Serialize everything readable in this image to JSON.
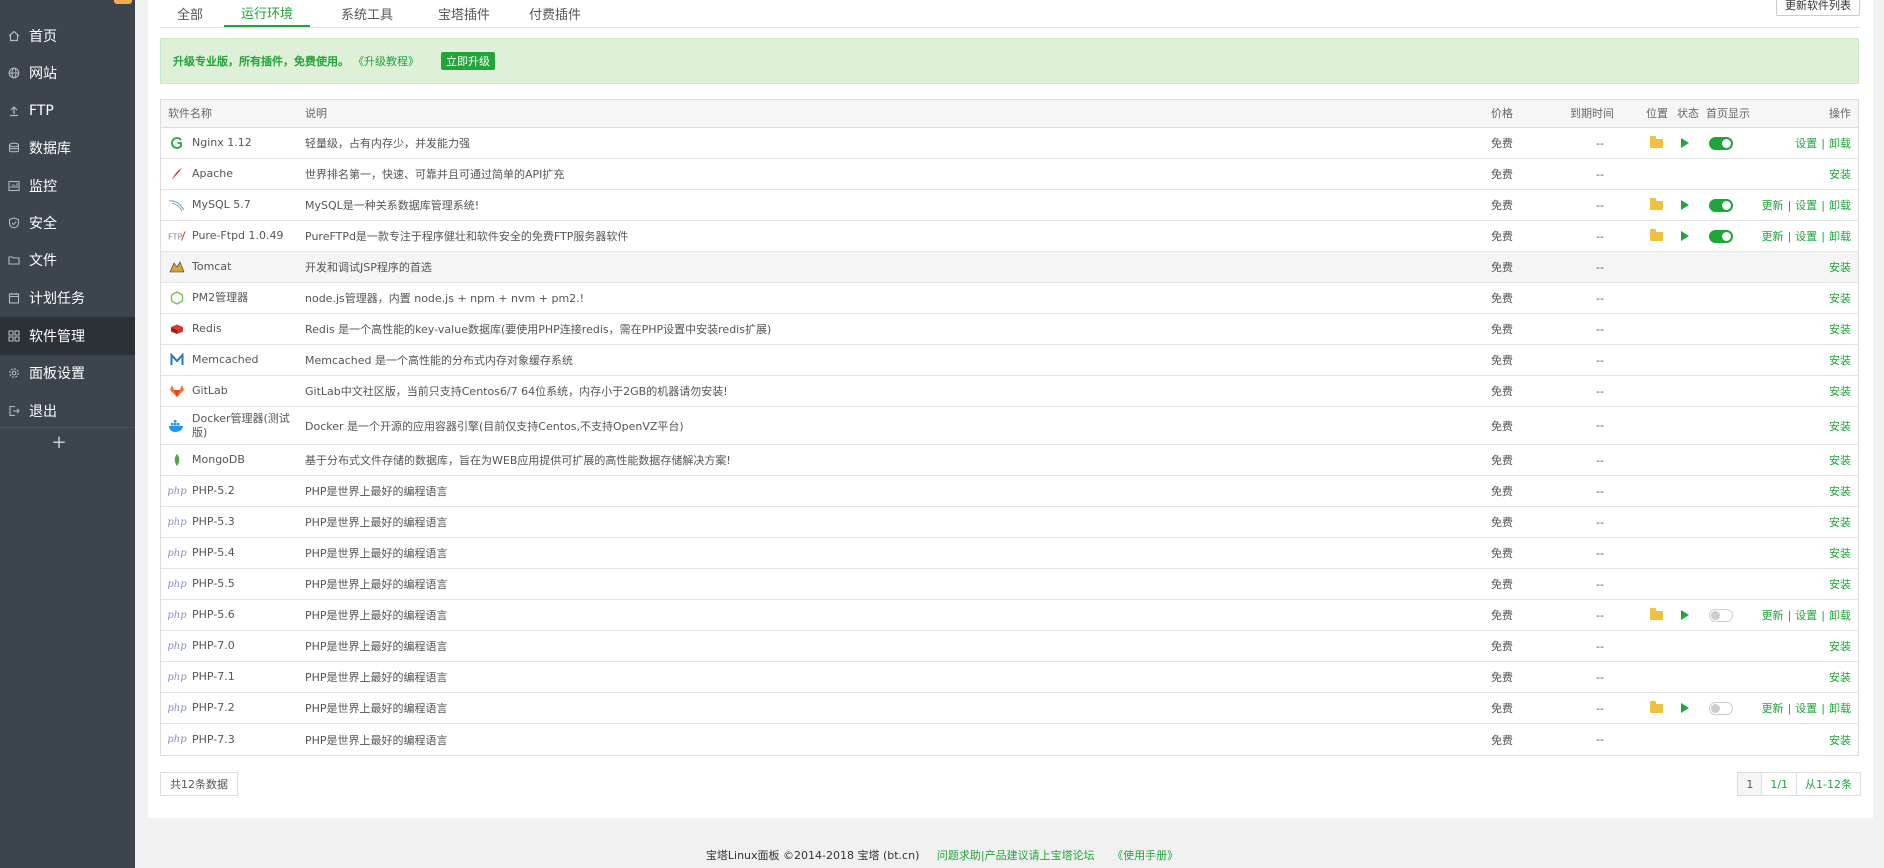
{
  "sidebar": {
    "items": [
      {
        "label": "首页",
        "icon": "home-icon"
      },
      {
        "label": "网站",
        "icon": "globe-icon"
      },
      {
        "label": "FTP",
        "icon": "upload-icon"
      },
      {
        "label": "数据库",
        "icon": "database-icon"
      },
      {
        "label": "监控",
        "icon": "monitor-icon"
      },
      {
        "label": "安全",
        "icon": "shield-icon"
      },
      {
        "label": "文件",
        "icon": "folder-icon"
      },
      {
        "label": "计划任务",
        "icon": "calendar-icon"
      },
      {
        "label": "软件管理",
        "icon": "grid-icon"
      },
      {
        "label": "面板设置",
        "icon": "gear-icon"
      },
      {
        "label": "退出",
        "icon": "logout-icon"
      }
    ],
    "add_icon": "+"
  },
  "tabs": [
    "全部",
    "运行环境",
    "系统工具",
    "宝塔插件",
    "付费插件"
  ],
  "refresh_button": "更新软件列表",
  "alert": {
    "text": "升级专业版，所有插件，免费使用。",
    "link": "《升级教程》",
    "button": "立即升级"
  },
  "table": {
    "headers": {
      "name": "软件名称",
      "desc": "说明",
      "price": "价格",
      "expire": "到期时间",
      "location": "位置",
      "state": "状态",
      "show": "首页显示",
      "ops": "操作"
    },
    "rows": [
      {
        "name": "Nginx 1.12",
        "desc": "轻量级，占有内存少，并发能力强",
        "price": "免费",
        "expire": "--",
        "installed": true,
        "toggle": "on",
        "ops": [
          "设置",
          "卸载"
        ],
        "logo": "nginx-logo-icon"
      },
      {
        "name": "Apache",
        "desc": "世界排名第一，快速、可靠并且可通过简单的API扩充",
        "price": "免费",
        "expire": "--",
        "installed": false,
        "ops": [
          "安装"
        ],
        "logo": "apache-logo-icon"
      },
      {
        "name": "MySQL 5.7",
        "desc": "MySQL是一种关系数据库管理系统!",
        "price": "免费",
        "expire": "--",
        "installed": true,
        "toggle": "on",
        "ops": [
          "更新",
          "设置",
          "卸载"
        ],
        "logo": "mysql-logo-icon"
      },
      {
        "name": "Pure-Ftpd 1.0.49",
        "desc": "PureFTPd是一款专注于程序健壮和软件安全的免费FTP服务器软件",
        "price": "免费",
        "expire": "--",
        "installed": true,
        "toggle": "on",
        "ops": [
          "更新",
          "设置",
          "卸载"
        ],
        "logo": "ftp-logo-icon"
      },
      {
        "name": "Tomcat",
        "desc": "开发和调试JSP程序的首选",
        "price": "免费",
        "expire": "--",
        "installed": false,
        "ops": [
          "安装"
        ],
        "logo": "tomcat-logo-icon",
        "highlight": true
      },
      {
        "name": "PM2管理器",
        "desc": "node.js管理器，内置 node.js + npm + nvm + pm2.!",
        "price": "免费",
        "expire": "--",
        "installed": false,
        "ops": [
          "安装"
        ],
        "logo": "nodejs-logo-icon"
      },
      {
        "name": "Redis",
        "desc": "Redis 是一个高性能的key-value数据库(要使用PHP连接redis，需在PHP设置中安装redis扩展)",
        "price": "免费",
        "expire": "--",
        "installed": false,
        "ops": [
          "安装"
        ],
        "logo": "redis-logo-icon"
      },
      {
        "name": "Memcached",
        "desc": "Memcached 是一个高性能的分布式内存对象缓存系统",
        "price": "免费",
        "expire": "--",
        "installed": false,
        "ops": [
          "安装"
        ],
        "logo": "memcached-logo-icon"
      },
      {
        "name": "GitLab",
        "desc": "GitLab中文社区版，当前只支持Centos6/7 64位系统，内存小于2GB的机器请勿安装!",
        "price": "免费",
        "expire": "--",
        "installed": false,
        "ops": [
          "安装"
        ],
        "logo": "gitlab-logo-icon"
      },
      {
        "name": "Docker管理器(测试版)",
        "desc": "Docker 是一个开源的应用容器引擎(目前仅支持Centos,不支持OpenVZ平台)",
        "price": "免费",
        "expire": "--",
        "installed": false,
        "ops": [
          "安装"
        ],
        "logo": "docker-logo-icon",
        "tall": true
      },
      {
        "name": "MongoDB",
        "desc": "基于分布式文件存储的数据库，旨在为WEB应用提供可扩展的高性能数据存储解决方案!",
        "price": "免费",
        "expire": "--",
        "installed": false,
        "ops": [
          "安装"
        ],
        "logo": "mongodb-logo-icon"
      },
      {
        "name": "PHP-5.2",
        "desc": "PHP是世界上最好的编程语言",
        "price": "免费",
        "expire": "--",
        "installed": false,
        "ops": [
          "安装"
        ],
        "logo": "php-logo-icon"
      },
      {
        "name": "PHP-5.3",
        "desc": "PHP是世界上最好的编程语言",
        "price": "免费",
        "expire": "--",
        "installed": false,
        "ops": [
          "安装"
        ],
        "logo": "php-logo-icon"
      },
      {
        "name": "PHP-5.4",
        "desc": "PHP是世界上最好的编程语言",
        "price": "免费",
        "expire": "--",
        "installed": false,
        "ops": [
          "安装"
        ],
        "logo": "php-logo-icon"
      },
      {
        "name": "PHP-5.5",
        "desc": "PHP是世界上最好的编程语言",
        "price": "免费",
        "expire": "--",
        "installed": false,
        "ops": [
          "安装"
        ],
        "logo": "php-logo-icon"
      },
      {
        "name": "PHP-5.6",
        "desc": "PHP是世界上最好的编程语言",
        "price": "免费",
        "expire": "--",
        "installed": true,
        "toggle": "off",
        "ops": [
          "更新",
          "设置",
          "卸载"
        ],
        "logo": "php-logo-icon"
      },
      {
        "name": "PHP-7.0",
        "desc": "PHP是世界上最好的编程语言",
        "price": "免费",
        "expire": "--",
        "installed": false,
        "ops": [
          "安装"
        ],
        "logo": "php-logo-icon"
      },
      {
        "name": "PHP-7.1",
        "desc": "PHP是世界上最好的编程语言",
        "price": "免费",
        "expire": "--",
        "installed": false,
        "ops": [
          "安装"
        ],
        "logo": "php-logo-icon"
      },
      {
        "name": "PHP-7.2",
        "desc": "PHP是世界上最好的编程语言",
        "price": "免费",
        "expire": "--",
        "installed": true,
        "toggle": "off",
        "ops": [
          "更新",
          "设置",
          "卸载"
        ],
        "logo": "php-logo-icon"
      },
      {
        "name": "PHP-7.3",
        "desc": "PHP是世界上最好的编程语言",
        "price": "免费",
        "expire": "--",
        "installed": false,
        "ops": [
          "安装"
        ],
        "logo": "php-logo-icon"
      }
    ]
  },
  "footer": {
    "total": "共12条数据",
    "pager": [
      "1",
      "1/1",
      "从1-12条"
    ]
  },
  "copyright": {
    "text": "宝塔Linux面板 ©2014-2018 宝塔 (bt.cn)",
    "forum": "问题求助|产品建议请上宝塔论坛",
    "manual": "《使用手册》"
  },
  "colors": {
    "accent": "#20a53a",
    "sidebar_bg": "#3c444d",
    "sidebar_active": "#2c3138"
  }
}
